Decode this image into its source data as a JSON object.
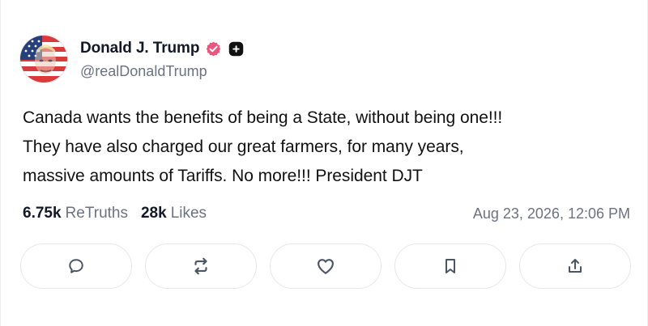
{
  "post": {
    "author": {
      "display_name": "Donald J. Trump",
      "handle": "@realDonaldTrump",
      "avatar_icon": "flag-portrait-avatar",
      "verified_icon": "verified-badge-icon",
      "plus_badge_icon": "plus-badge-icon"
    },
    "text_lines": [
      "Canada wants the benefits of being a State, without being one!!!",
      "They have also charged our great farmers, for many years,",
      "massive amounts of Tariffs. No more!!! President DJT"
    ],
    "stats": {
      "retruths_value": "6.75k",
      "retruths_label": "ReTruths",
      "likes_value": "28k",
      "likes_label": "Likes"
    },
    "timestamp": "Aug 23, 2026, 12:06 PM",
    "actions": [
      {
        "name": "reply",
        "icon": "chat-bubble-icon"
      },
      {
        "name": "retruth",
        "icon": "repost-arrows-icon"
      },
      {
        "name": "like",
        "icon": "heart-icon"
      },
      {
        "name": "bookmark",
        "icon": "bookmark-icon"
      },
      {
        "name": "share",
        "icon": "share-upload-icon"
      }
    ]
  },
  "colors": {
    "text_primary": "#111827",
    "text_secondary": "#6b7280",
    "verified_badge": "#e8577f",
    "border": "#e5e7eb"
  }
}
